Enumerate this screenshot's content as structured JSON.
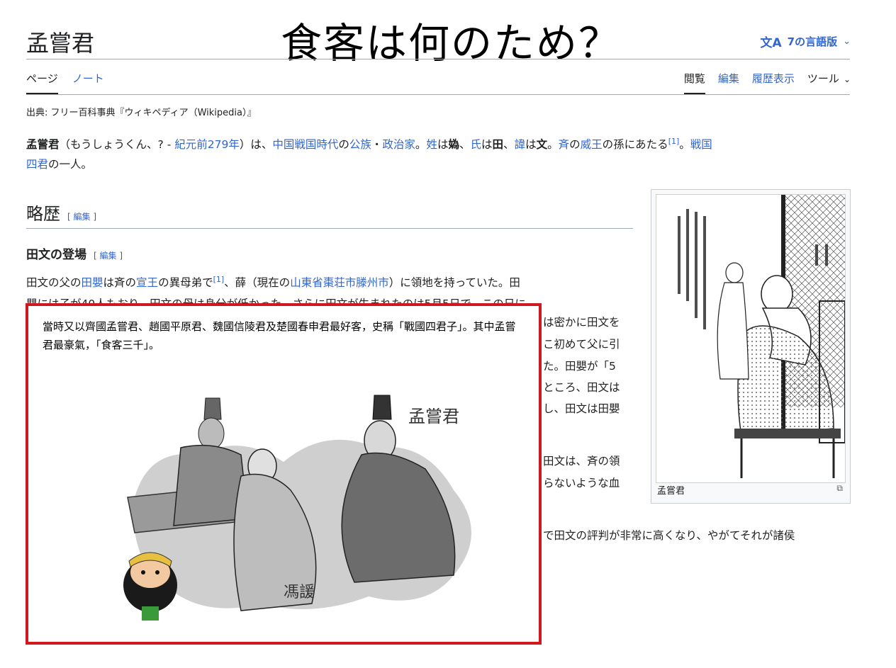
{
  "header": {
    "title": "孟嘗君",
    "overlay_title": "食客は何のため？",
    "language_icon": "translate-icon",
    "language_glyph": "文A",
    "language_label": "7の言語版",
    "chevron": "⌄"
  },
  "tabs": {
    "left": [
      {
        "label": "ページ",
        "active": true
      },
      {
        "label": "ノート",
        "active": false
      }
    ],
    "right": [
      {
        "label": "閲覧",
        "active": true
      },
      {
        "label": "編集",
        "active": false
      },
      {
        "label": "履歴表示",
        "active": false
      },
      {
        "label": "ツール",
        "active": false
      }
    ],
    "chevron": "⌄"
  },
  "source_line": "出典: フリー百科事典『ウィキペディア（Wikipedia）』",
  "lead": {
    "bold_name": "孟嘗君",
    "t1": "（もうしょうくん、? - ",
    "l_year": "紀元前279年",
    "t2": "）は、",
    "l_era": "中国戦国時代",
    "t3": "の",
    "l_clan": "公族",
    "t4": "・",
    "l_pol": "政治家",
    "t5": "。",
    "l_sei": "姓",
    "t6": "は",
    "b_sei": "媯",
    "t7": "、",
    "l_shi": "氏",
    "t8": "は",
    "b_shi": "田",
    "t9": "、",
    "l_imina": "諱",
    "t10": "は",
    "b_imina": "文",
    "t11": "。",
    "l_sei2": "斉",
    "t12": "の",
    "l_king": "威王",
    "t13": "の孫にあたる",
    "ref": "[1]",
    "t14": "。",
    "l_four": "戦国",
    "l_four2": "四君",
    "t15": "の一人。"
  },
  "section": {
    "heading": "略歴",
    "edit": "[ 編集 ]"
  },
  "subsection": {
    "heading": "田文の登場",
    "edit": "[ 編集 ]"
  },
  "body": {
    "line1_a": "田文の父の",
    "line1_l1": "田嬰",
    "line1_b": "は斉の",
    "line1_l2": "宣王",
    "line1_c": "の異母弟で",
    "line1_ref": "[1]",
    "line1_d": "、薛（現在の",
    "line1_l3": "山東省棗荘市滕州市",
    "line1_e": "）に領地を持っていた。田",
    "line2": "嬰には子が40人もおり、田文の母は身分が低かった。さらに田文が生まれたのは5月5日で、この日に",
    "frag1": "は密かに田文を",
    "frag2": "こ初めて父に引",
    "frag3": "た。田嬰が「5",
    "frag4": "ところ、田文は",
    "frag5": "し、田文は田嬰",
    "frag6": "田文は、斉の領",
    "frag7": "らないような血",
    "frag8": "で田文の評判が非常に高くなり、やがてそれが諸侯"
  },
  "infobox": {
    "caption": "孟嘗君",
    "expand_icon": "expand-icon",
    "expand_glyph": "⧉"
  },
  "overlay_panel": {
    "quote": "當時又以齊國孟嘗君、趙國平原君、魏國信陵君及楚國春申君最好客，史稱「戰國四君子」。其中孟嘗君最豪氣，「食客三千」。",
    "label_lord": "孟嘗君",
    "label_guest": "馮諼"
  },
  "colors": {
    "link": "#3366cc",
    "text": "#202122",
    "highlight_border": "#d0191e",
    "rule": "#a2a9b1"
  }
}
